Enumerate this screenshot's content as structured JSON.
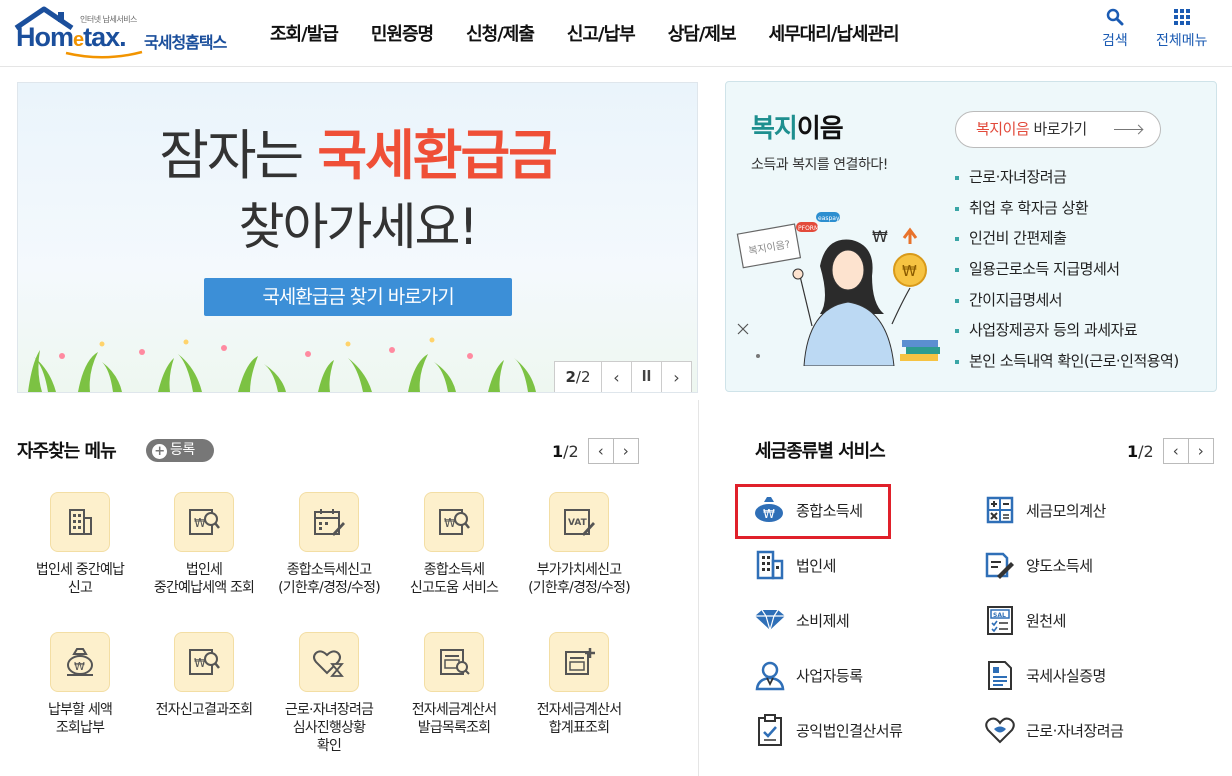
{
  "header": {
    "logo": {
      "small_text": "인터넷 납세서비스",
      "brand_home": "Hom",
      "brand_e": "e",
      "brand_tax": "tax.",
      "brand_kr": "국세청홈택스"
    },
    "gnb": [
      "조회/발급",
      "민원증명",
      "신청/제출",
      "신고/납부",
      "상담/제보",
      "세무대리/납세관리"
    ],
    "search_label": "검색",
    "menu_label": "전체메뉴",
    "accent": "#1b5bb3"
  },
  "banner": {
    "line1_plain": "잠자는 ",
    "line1_highlight": "국세환급금",
    "line2": "찾아가세요!",
    "button": "국세환급금 찾기 바로가기",
    "pager_current": "2",
    "pager_total": "/2",
    "prev_icon": "chevron-left-icon",
    "pause_icon": "pause-icon",
    "next_icon": "chevron-right-icon"
  },
  "welfare": {
    "title_highlight": "복지",
    "title_rest": "이음",
    "subtitle": "소득과 복지를 연결하다!",
    "button_highlight": "복지이음",
    "button_rest": " 바로가기",
    "illust_sign": "복지이음?",
    "illust_tag1": "easpay",
    "illust_tag2": "PFORM",
    "items": [
      "근로·자녀장려금",
      "취업 후 학자금 상환",
      "인건비 간편제출",
      "일용근로소득 지급명세서",
      "간이지급명세서",
      "사업장제공자 등의 과세자료",
      "본인 소득내역 확인(근로·인적용역)"
    ]
  },
  "favorites": {
    "title": "자주찾는 메뉴",
    "register": "등록",
    "pager_current": "1",
    "pager_total": "/2",
    "items": [
      {
        "label": "법인세 중간예납\n신고",
        "icon": "building-icon"
      },
      {
        "label": "법인세\n중간예납세액 조회",
        "icon": "won-search-icon"
      },
      {
        "label": "종합소득세신고\n(기한후/경정/수정)",
        "icon": "calendar-edit-icon"
      },
      {
        "label": "종합소득세\n신고도움 서비스",
        "icon": "won-search-icon"
      },
      {
        "label": "부가가치세신고\n(기한후/경정/수정)",
        "icon": "vat-edit-icon"
      },
      {
        "label": "납부할 세액\n조회납부",
        "icon": "money-bag-icon"
      },
      {
        "label": "전자신고결과조회",
        "icon": "won-search-icon"
      },
      {
        "label": "근로·자녀장려금\n심사진행상황\n확인",
        "icon": "heart-hourglass-icon"
      },
      {
        "label": "전자세금계산서\n발급목록조회",
        "icon": "invoice-list-icon"
      },
      {
        "label": "전자세금계산서\n합계표조회",
        "icon": "invoice-plus-icon"
      }
    ],
    "vat_text": "VAT"
  },
  "tax_service": {
    "title": "세금종류별 서비스",
    "pager_current": "1",
    "pager_total": "/2",
    "items": [
      {
        "label": "종합소득세",
        "icon": "money-bag-icon"
      },
      {
        "label": "세금모의계산",
        "icon": "calculator-icon"
      },
      {
        "label": "법인세",
        "icon": "building-icon"
      },
      {
        "label": "양도소득세",
        "icon": "document-edit-icon"
      },
      {
        "label": "소비제세",
        "icon": "diamond-icon"
      },
      {
        "label": "원천세",
        "icon": "receipt-icon"
      },
      {
        "label": "사업자등록",
        "icon": "person-icon"
      },
      {
        "label": "국세사실증명",
        "icon": "certificate-icon"
      },
      {
        "label": "공익법인결산서류",
        "icon": "clipboard-check-icon"
      },
      {
        "label": "근로·자녀장려금",
        "icon": "heart-icon"
      }
    ],
    "sal_text": "SAL",
    "highlight_color": "#e0202a"
  }
}
